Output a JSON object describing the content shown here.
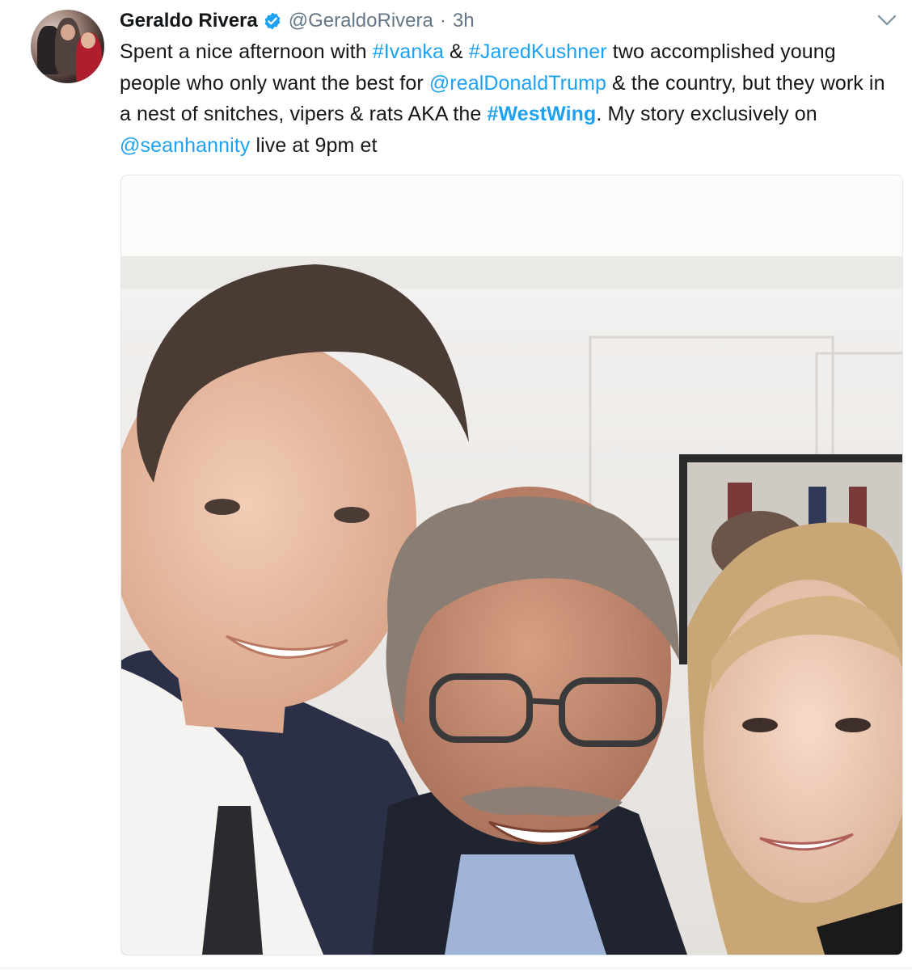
{
  "tweet": {
    "author_name": "Geraldo Rivera",
    "author_handle": "@GeraldoRivera",
    "separator": "·",
    "timestamp": "3h",
    "verified_icon": "verified-badge-icon",
    "menu_icon": "chevron-down-icon",
    "text_parts": {
      "t1": "Spent a nice afternoon with ",
      "h_ivanka": "#Ivanka",
      "t2": " & ",
      "h_jared": "#JaredKushner",
      "t3": " two accomplished young people who only want the best for ",
      "m_trump": "@realDonaldTrump",
      "t4": " & the country, but they work in a nest of snitches, vipers & rats AKA the ",
      "h_westwing": "#WestWing",
      "t5": ". My story exclusively on ",
      "m_hannity": "@seanhannity",
      "t6": " live at 9pm et"
    }
  },
  "colors": {
    "link": "#1da1f2",
    "secondary_text": "#657786",
    "primary_text": "#14171a",
    "verified": "#1da1f2"
  }
}
